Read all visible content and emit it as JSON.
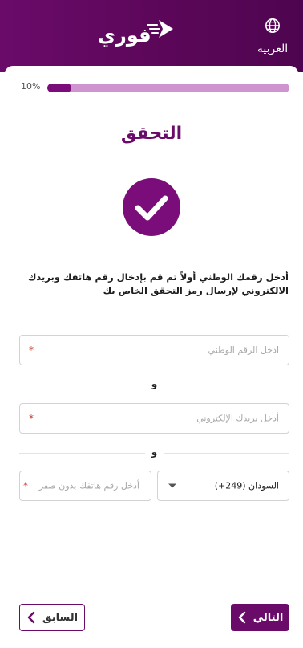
{
  "header": {
    "brand": "فوري",
    "language_label": "العربية",
    "language_icon": "globe-icon",
    "background_color": "#5a0657"
  },
  "progress": {
    "label": "10%",
    "value": 0.1
  },
  "page": {
    "title": "التحقق",
    "status_icon": "checkmark-circle-icon",
    "instructions_line1": "أدخل رقمك الوطني أولاً ثم قم بإدخال رقم هاتفك وبريدك",
    "instructions_line2": "الالكتروني لإرسال رمز التحقق الخاص بك"
  },
  "form": {
    "national_id_placeholder": "ادخل الرقم الوطني",
    "separator1": "و",
    "email_placeholder": "أدخل بريدك الإلكتروني",
    "separator2": "و",
    "country_value": "السودان (249+)",
    "phone_placeholder": "أدخل رقم هاتفك بدون صفر",
    "required_mark": "*"
  },
  "actions": {
    "next_label": "التالي",
    "prev_label": "السابق"
  },
  "colors": {
    "accent": "#6a0b6a",
    "progress_track": "#cf93cf",
    "required": "#c0392b"
  }
}
